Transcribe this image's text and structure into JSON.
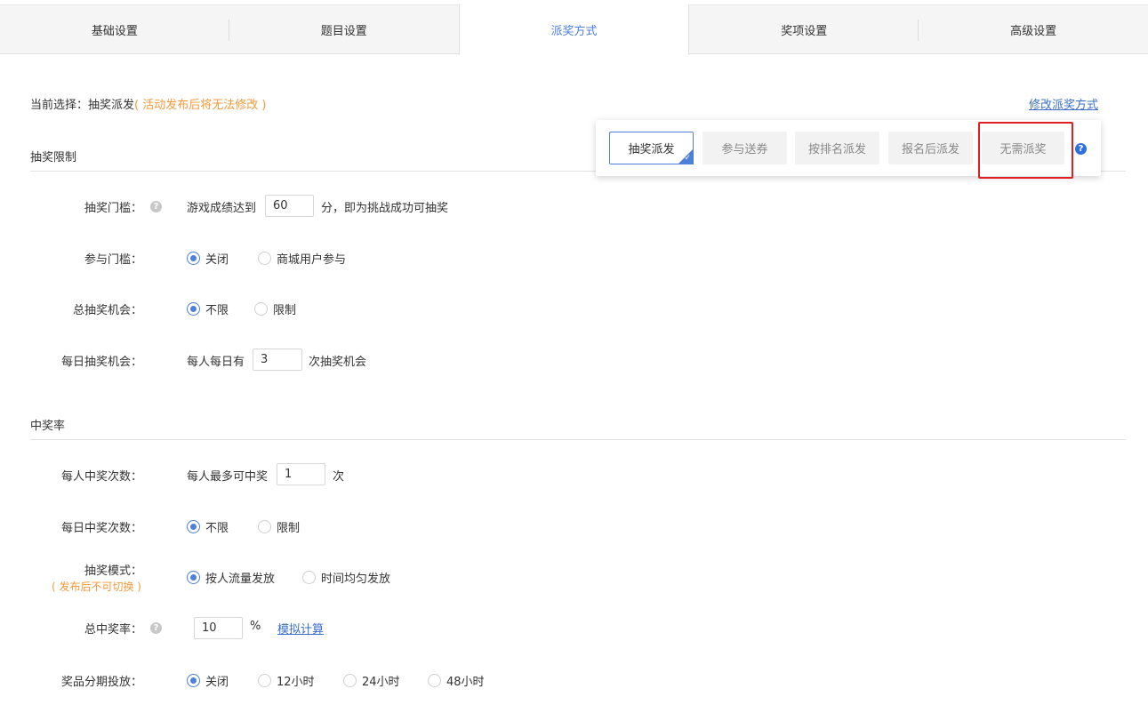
{
  "tabs": [
    {
      "label": "基础设置"
    },
    {
      "label": "题目设置"
    },
    {
      "label": "派奖方式",
      "active": true
    },
    {
      "label": "奖项设置"
    },
    {
      "label": "高级设置"
    }
  ],
  "current": {
    "prefix": "当前选择：抽奖派发",
    "warning": "( 活动发布后将无法修改 )"
  },
  "modify_link": "修改派奖方式",
  "popup": {
    "options": [
      "抽奖派发",
      "参与送券",
      "按排名派发",
      "报名后派发",
      "无需派奖"
    ],
    "selected": "抽奖派发",
    "help": "?"
  },
  "section_limit": {
    "title": "抽奖限制",
    "threshold": {
      "label": "抽奖门槛：",
      "pre": "游戏成绩达到",
      "value": "60",
      "post": "分，即为挑战成功可抽奖"
    },
    "participate": {
      "label": "参与门槛：",
      "options": [
        "关闭",
        "商城用户参与"
      ],
      "selected": "关闭"
    },
    "total_chances": {
      "label": "总抽奖机会：",
      "options": [
        "不限",
        "限制"
      ],
      "selected": "不限"
    },
    "daily_chances": {
      "label": "每日抽奖机会：",
      "pre": "每人每日有",
      "value": "3",
      "post": "次抽奖机会"
    }
  },
  "section_rate": {
    "title": "中奖率",
    "per_person": {
      "label": "每人中奖次数：",
      "pre": "每人最多可中奖",
      "value": "1",
      "post": "次"
    },
    "daily_wins": {
      "label": "每日中奖次数：",
      "options": [
        "不限",
        "限制"
      ],
      "selected": "不限"
    },
    "mode": {
      "label": "抽奖模式：",
      "note": "( 发布后不可切换 )",
      "options": [
        "按人流量发放",
        "时间均匀发放"
      ],
      "selected": "按人流量发放"
    },
    "total_rate": {
      "label": "总中奖率：",
      "value": "10",
      "unit": "%",
      "link": "模拟计算"
    },
    "staged": {
      "label": "奖品分期投放：",
      "options": [
        "关闭",
        "12小时",
        "24小时",
        "48小时"
      ],
      "selected": "关闭"
    }
  },
  "colors": {
    "accent": "#4e7fd9",
    "warning": "#f39a3b",
    "highlight": "#e02020"
  }
}
